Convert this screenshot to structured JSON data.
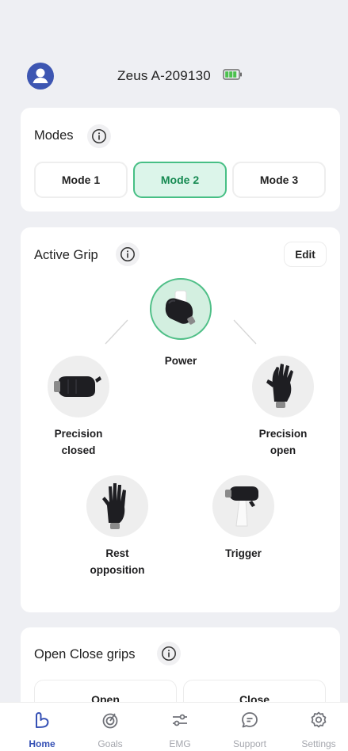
{
  "header": {
    "device_name": "Zeus A-209130",
    "battery_color": "#4cc04e"
  },
  "modes": {
    "title": "Modes",
    "items": [
      {
        "label": "Mode 1",
        "active": false
      },
      {
        "label": "Mode 2",
        "active": true
      },
      {
        "label": "Mode 3",
        "active": false
      }
    ]
  },
  "active_grip": {
    "title": "Active Grip",
    "edit_label": "Edit",
    "grips": [
      {
        "line1": "Power",
        "line2": "",
        "icon": "power-grip-hand-icon",
        "active": true
      },
      {
        "line1": "Precision",
        "line2": "closed",
        "icon": "precision-closed-hand-icon",
        "active": false
      },
      {
        "line1": "Precision",
        "line2": "open",
        "icon": "precision-open-hand-icon",
        "active": false
      },
      {
        "line1": "Rest",
        "line2": "opposition",
        "icon": "rest-opposition-hand-icon",
        "active": false
      },
      {
        "line1": "Trigger",
        "line2": "",
        "icon": "trigger-grip-hand-icon",
        "active": false
      }
    ]
  },
  "open_close": {
    "title": "Open Close grips",
    "open_label": "Open",
    "close_label": "Close"
  },
  "nav": {
    "items": [
      {
        "label": "Home",
        "icon": "home-arm-icon",
        "active": true
      },
      {
        "label": "Goals",
        "icon": "goals-target-icon",
        "active": false
      },
      {
        "label": "EMG",
        "icon": "emg-sliders-icon",
        "active": false
      },
      {
        "label": "Support",
        "icon": "support-chat-icon",
        "active": false
      },
      {
        "label": "Settings",
        "icon": "settings-gear-icon",
        "active": false
      }
    ]
  },
  "colors": {
    "accent": "#3651b5",
    "active_green": "#47bf85",
    "active_green_bg": "#dcf5ea"
  }
}
